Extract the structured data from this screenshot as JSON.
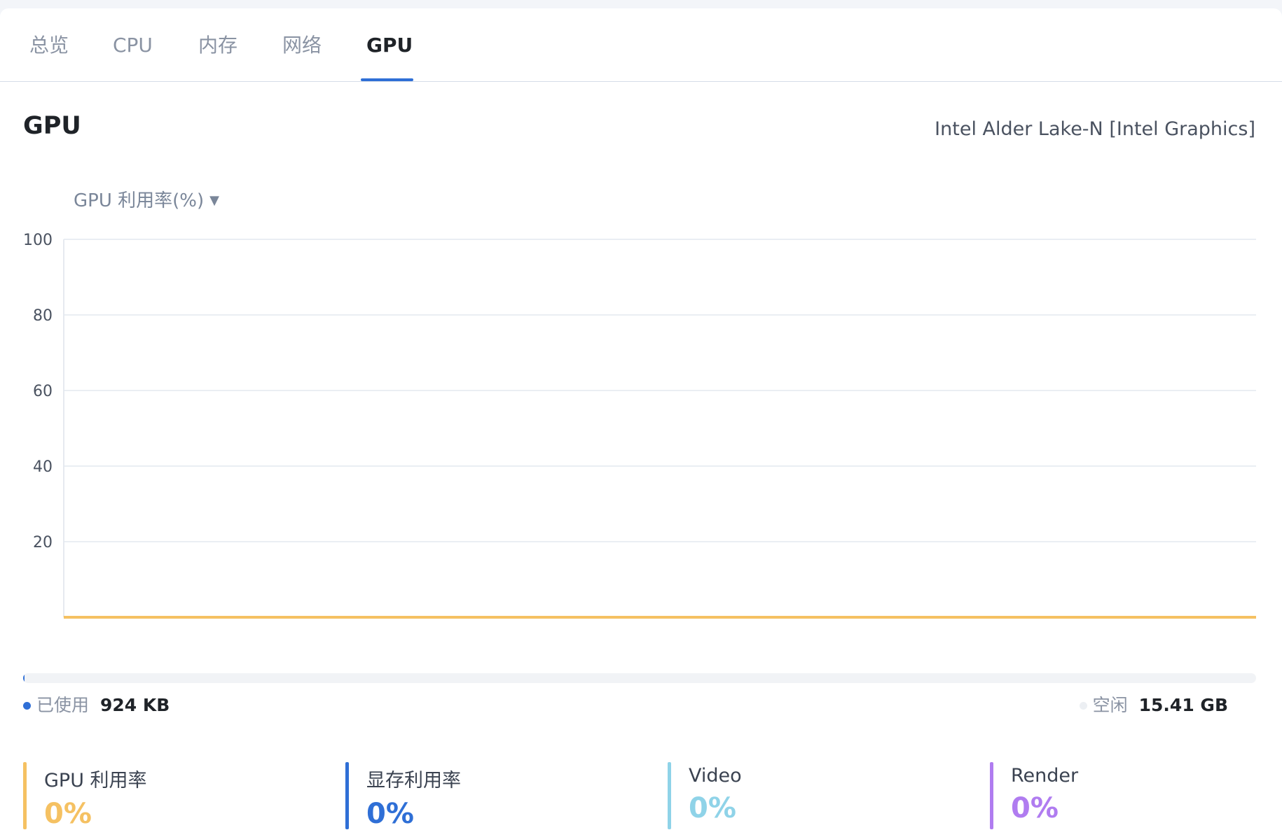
{
  "tabs": [
    {
      "label": "总览"
    },
    {
      "label": "CPU"
    },
    {
      "label": "内存"
    },
    {
      "label": "网络"
    },
    {
      "label": "GPU"
    }
  ],
  "active_tab": "GPU",
  "section": {
    "title": "GPU",
    "device": "Intel Alder Lake-N [Intel Graphics]"
  },
  "metric_select": {
    "selected": "GPU 利用率(%)",
    "caret_icon": "caret-down-icon"
  },
  "chart_data": {
    "type": "line",
    "yticks": [
      "100",
      "80",
      "60",
      "40",
      "20"
    ],
    "ylim": [
      0,
      100
    ],
    "grid": true,
    "series": [
      {
        "color": "#f5c162",
        "values": [
          0,
          0
        ]
      }
    ]
  },
  "memory": {
    "used_label": "已使用",
    "used_value": "924 KB",
    "free_label": "空闲",
    "free_value": "15.41 GB",
    "used_fraction": 0.0001,
    "used_color": "#2f6fd6",
    "free_color": "#eceff3"
  },
  "stats": [
    {
      "label": "GPU 利用率",
      "value": "0%",
      "color": "#f5c162"
    },
    {
      "label": "显存利用率",
      "value": "0%",
      "color": "#2f6fd6"
    },
    {
      "label": "Video",
      "value": "0%",
      "color": "#8fd3e8"
    },
    {
      "label": "Render",
      "value": "0%",
      "color": "#b07cf0"
    }
  ]
}
